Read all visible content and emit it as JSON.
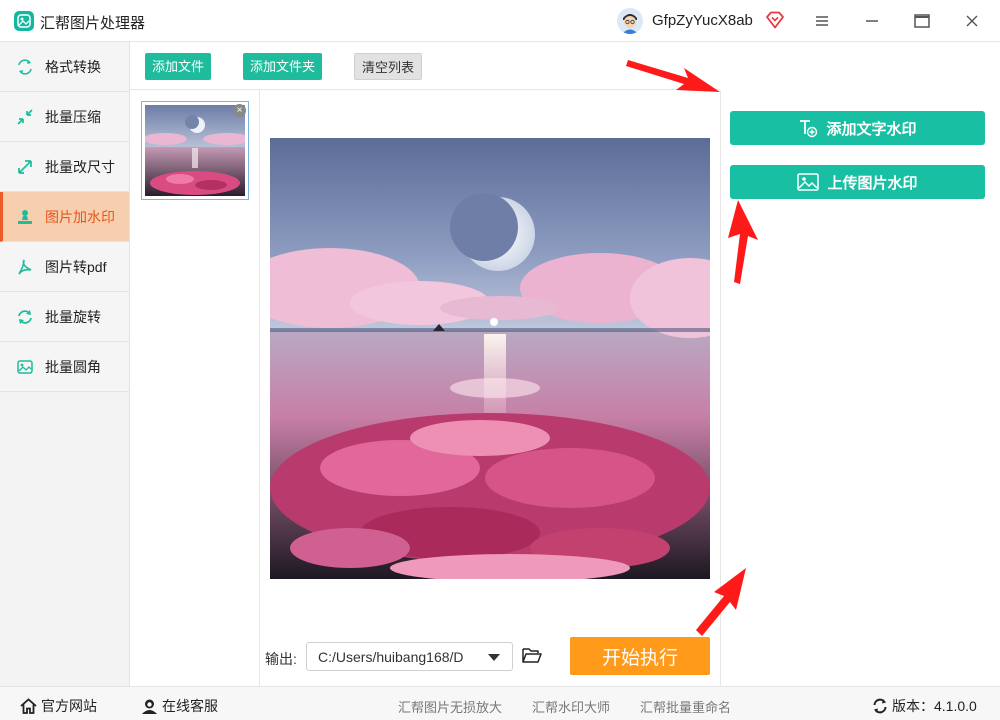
{
  "app": {
    "title": "汇帮图片处理器"
  },
  "user": {
    "name": "GfpZyYucX8ab"
  },
  "sidebar": {
    "items": [
      {
        "label": "格式转换",
        "icon": "format-convert-icon"
      },
      {
        "label": "批量压缩",
        "icon": "compress-icon"
      },
      {
        "label": "批量改尺寸",
        "icon": "resize-icon"
      },
      {
        "label": "图片加水印",
        "icon": "watermark-icon",
        "active": true
      },
      {
        "label": "图片转pdf",
        "icon": "pdf-icon"
      },
      {
        "label": "批量旋转",
        "icon": "rotate-icon"
      },
      {
        "label": "批量圆角",
        "icon": "rounded-corner-icon"
      }
    ]
  },
  "toolbar": {
    "add_file": "添加文件",
    "add_folder": "添加文件夹",
    "clear_list": "清空列表"
  },
  "watermark": {
    "add_text": "添加文字水印",
    "upload_image": "上传图片水印"
  },
  "output": {
    "label": "输出:",
    "path": "C:/Users/huibang168/D"
  },
  "actions": {
    "start": "开始执行"
  },
  "statusbar": {
    "website": "官方网站",
    "support": "在线客服",
    "links": [
      "汇帮图片无损放大",
      "汇帮水印大师",
      "汇帮批量重命名"
    ],
    "version_label": "版本：4.1.0.0"
  },
  "colors": {
    "accent_green": "#1ebc9c",
    "accent_orange": "#ff9a1a",
    "active_bg": "#f6cfae",
    "arrow_red": "#ff1a1a"
  }
}
